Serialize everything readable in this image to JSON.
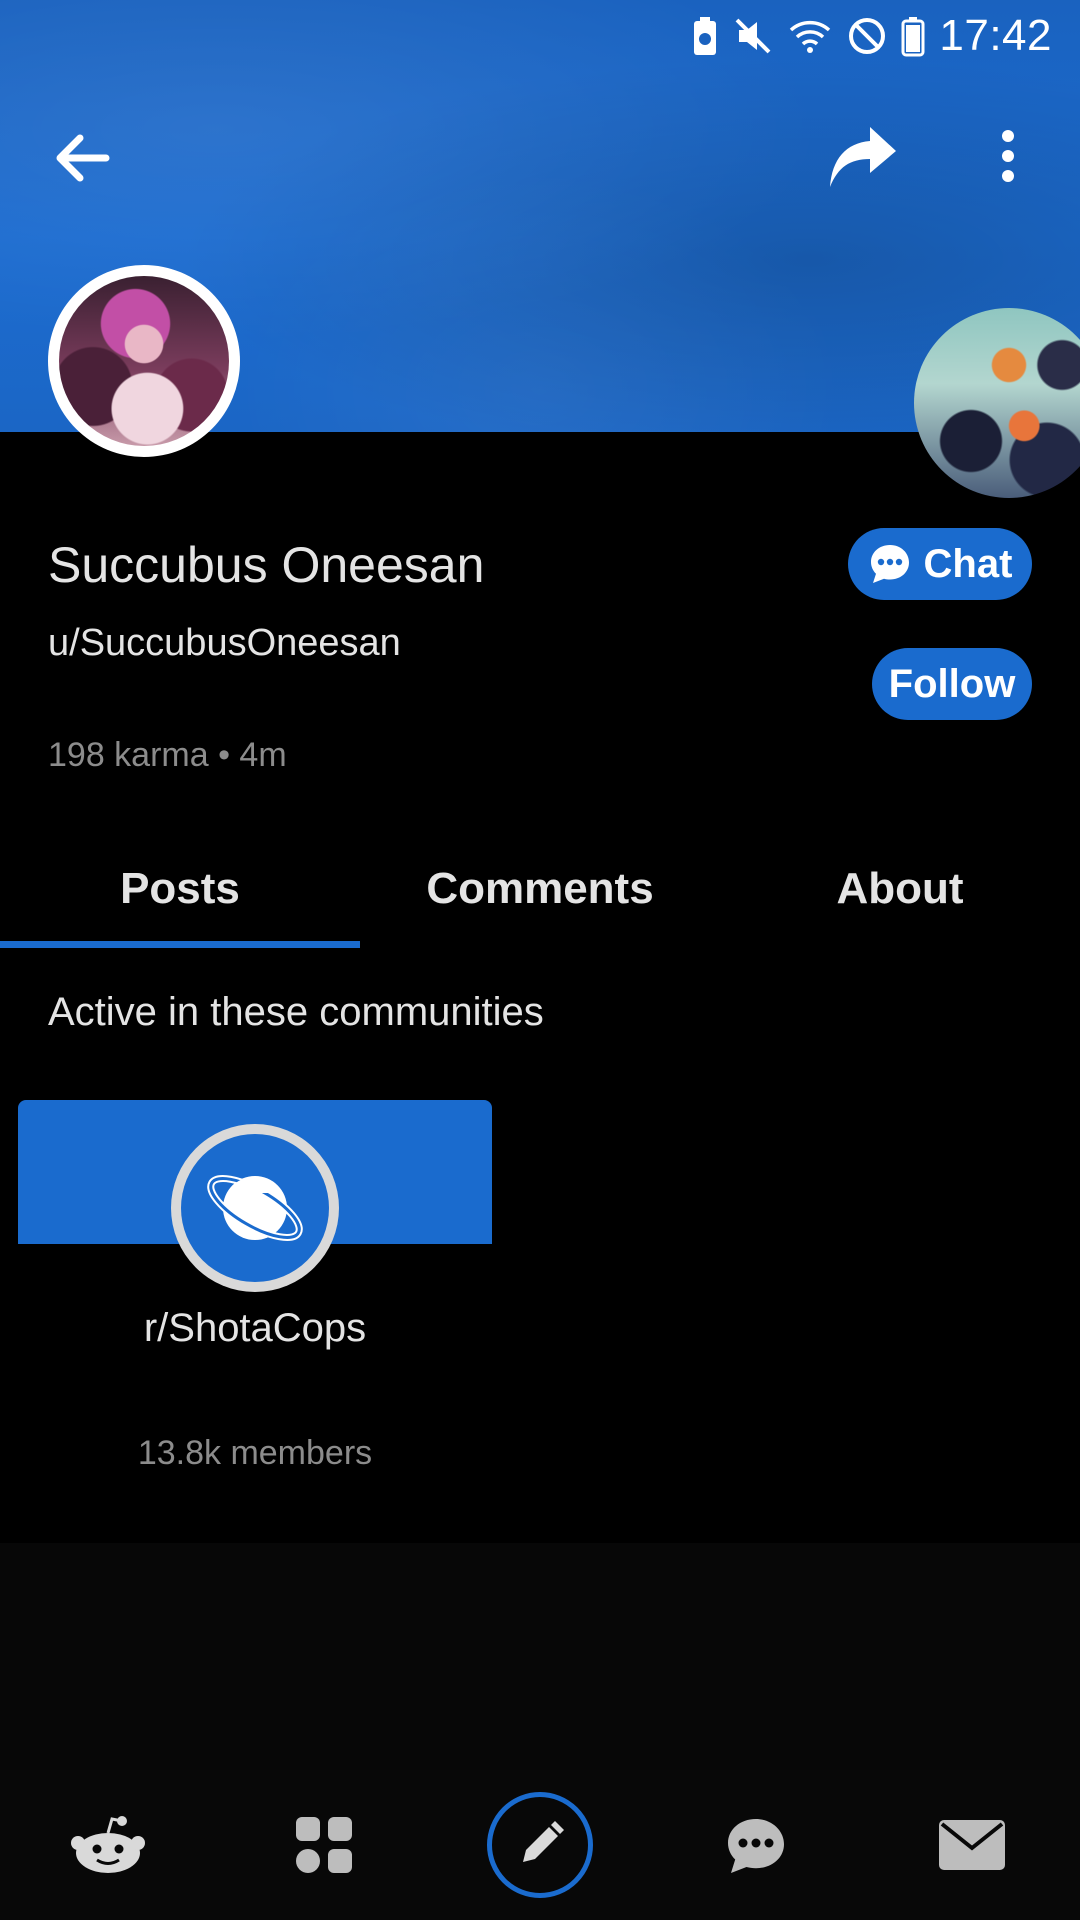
{
  "status_bar": {
    "time": "17:42",
    "icons": [
      "battery-saver-icon",
      "mute-icon",
      "wifi-icon",
      "do-not-disturb-icon",
      "battery-icon"
    ]
  },
  "header": {
    "back_icon": "arrow-left-icon",
    "share_icon": "share-arrow-icon",
    "more_icon": "vertical-dots-icon"
  },
  "profile": {
    "display_name": "Succubus Oneesan",
    "username": "u/SuccubusOneesan",
    "meta": "198 karma • 4m",
    "chat_label": "Chat",
    "follow_label": "Follow"
  },
  "tabs": [
    {
      "label": "Posts",
      "active": true
    },
    {
      "label": "Comments",
      "active": false
    },
    {
      "label": "About",
      "active": false
    }
  ],
  "section_title": "Active in these communities",
  "communities": [
    {
      "name": "r/ShotaCops",
      "members": "13.8k members"
    }
  ],
  "bottom_nav": [
    "reddit-home-icon",
    "communities-icon",
    "create-post-icon",
    "chat-icon",
    "inbox-icon"
  ],
  "colors": {
    "accent": "#1a6bce",
    "background": "#000000",
    "text": "#e4e4e4",
    "muted": "#8c8c8c"
  }
}
